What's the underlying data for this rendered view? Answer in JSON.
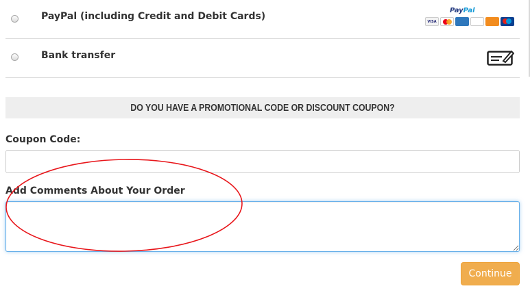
{
  "payment_methods": [
    {
      "label": "PayPal (including Credit and Debit Cards)",
      "selected": false,
      "icon": "paypal-cards-logo"
    },
    {
      "label": "Bank transfer",
      "selected": false,
      "icon": "bank-check-icon"
    }
  ],
  "paypal_logo": {
    "wordmark_first": "Pay",
    "wordmark_second": "Pal",
    "cards": [
      "VISA",
      "MC",
      "AMEX",
      "DISCOVER",
      "BANK",
      "Maestro"
    ]
  },
  "promo": {
    "heading": "DO YOU HAVE A PROMOTIONAL CODE OR DISCOUNT COUPON?"
  },
  "coupon": {
    "label": "Coupon Code:",
    "value": "",
    "placeholder": ""
  },
  "comments": {
    "label": "Add Comments About Your Order",
    "value": "",
    "placeholder": ""
  },
  "actions": {
    "continue_label": "Continue"
  },
  "colors": {
    "button_bg": "#f0ad4e",
    "banner_bg": "#eeeeee",
    "focus_border": "#66afe9",
    "annotation": "#e8161b"
  }
}
